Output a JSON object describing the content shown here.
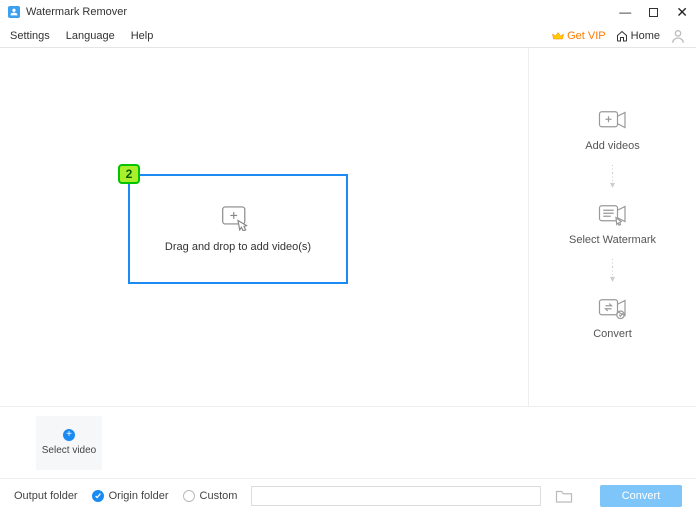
{
  "window": {
    "title": "Watermark Remover"
  },
  "menu": {
    "settings": "Settings",
    "language": "Language",
    "help": "Help",
    "getvip": "Get VIP",
    "home": "Home"
  },
  "dropzone": {
    "text": "Drag and drop to add video(s)",
    "badge": "2"
  },
  "steps": {
    "add": "Add videos",
    "select": "Select Watermark",
    "convert": "Convert"
  },
  "footer1": {
    "select_video": "Select video"
  },
  "footer2": {
    "output_folder": "Output folder",
    "origin_folder": "Origin folder",
    "custom": "Custom",
    "convert": "Convert"
  }
}
